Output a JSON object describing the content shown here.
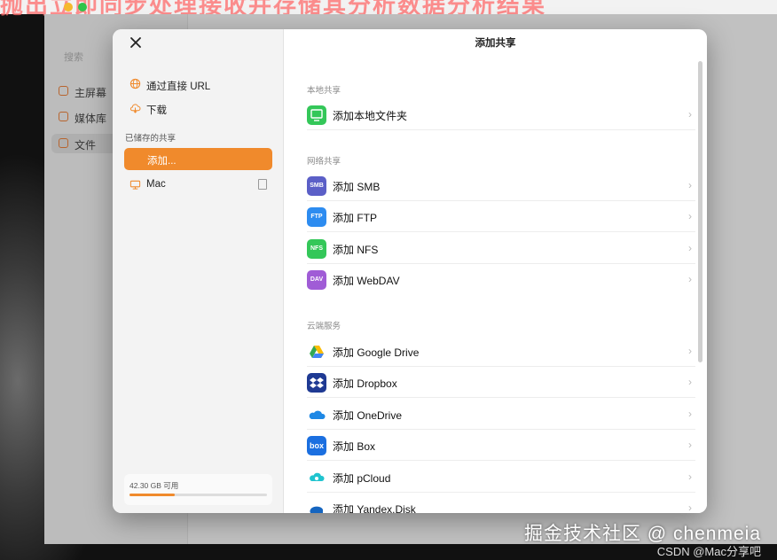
{
  "background": {
    "top_text": "抛出立即同步处理接收并存储其分析数据分析结果",
    "app_sidebar": {
      "search_placeholder": "搜索",
      "items": [
        {
          "label": "主屏幕",
          "active": false
        },
        {
          "label": "媒体库",
          "active": false
        },
        {
          "label": "文件",
          "active": true
        }
      ]
    }
  },
  "modal": {
    "close_icon": "close-icon",
    "title": "添加共享",
    "sidebar": {
      "items": [
        {
          "label": "通过直接 URL",
          "icon": "globe-icon",
          "color": "#f08a2c"
        },
        {
          "label": "下载",
          "icon": "cloud-download-icon",
          "color": "#f08a2c"
        }
      ],
      "saved_heading": "已储存的共享",
      "add_button": "添加...",
      "saved_item": "Mac",
      "storage_text": "42.30 GB 可用",
      "storage_used_fraction": 0.33
    },
    "sections": [
      {
        "heading": "本地共享",
        "rows": [
          {
            "label": "添加本地文件夹",
            "icon": "local-folder-icon",
            "badge": "",
            "color": "#34c759"
          }
        ]
      },
      {
        "heading": "网络共享",
        "rows": [
          {
            "label": "添加 SMB",
            "icon": "smb-icon",
            "badge": "SMB",
            "color": "#5b5fc7"
          },
          {
            "label": "添加 FTP",
            "icon": "ftp-icon",
            "badge": "FTP",
            "color": "#2d8cf0"
          },
          {
            "label": "添加 NFS",
            "icon": "nfs-icon",
            "badge": "NFS",
            "color": "#34c759"
          },
          {
            "label": "添加 WebDAV",
            "icon": "webdav-icon",
            "badge": "DAV",
            "color": "#a05cd6"
          }
        ]
      },
      {
        "heading": "云端服务",
        "rows": [
          {
            "label": "添加 Google Drive",
            "icon": "google-drive-icon",
            "badge": "",
            "color": "#ffffff"
          },
          {
            "label": "添加 Dropbox",
            "icon": "dropbox-icon",
            "badge": "",
            "color": "#1f3a93"
          },
          {
            "label": "添加 OneDrive",
            "icon": "onedrive-icon",
            "badge": "",
            "color": "#ffffff"
          },
          {
            "label": "添加 Box",
            "icon": "box-icon",
            "badge": "box",
            "color": "#1b6fe0"
          },
          {
            "label": "添加 pCloud",
            "icon": "pcloud-icon",
            "badge": "",
            "color": "#ffffff"
          },
          {
            "label": "添加 Yandex.Disk",
            "icon": "yandex-disk-icon",
            "badge": "",
            "color": "#ffffff"
          }
        ]
      }
    ]
  },
  "watermark": {
    "main": "掘金技术社区 @ chenmeia",
    "sub": "CSDN @Mac分享吧"
  }
}
